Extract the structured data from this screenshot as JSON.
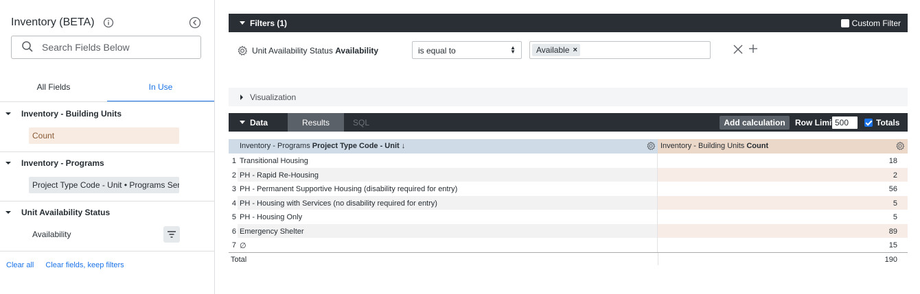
{
  "sidebar": {
    "title": "Inventory (BETA)",
    "search_placeholder": "Search Fields Below",
    "tabs": [
      {
        "label": "All Fields",
        "active": false
      },
      {
        "label": "In Use",
        "active": true
      }
    ],
    "groups": [
      {
        "title": "Inventory - Building Units",
        "field": "Count",
        "field_type": "measure"
      },
      {
        "title": "Inventory - Programs",
        "field": "Project Type Code - Unit • Programs Ser...",
        "field_type": "dimension"
      },
      {
        "title": "Unit Availability Status",
        "field": "Availability",
        "field_type": "filter"
      }
    ],
    "links": {
      "clear_all": "Clear all",
      "clear_keep": "Clear fields, keep filters"
    }
  },
  "filters": {
    "label": "Filters (1)",
    "custom_filter_label": "Custom Filter",
    "custom_filter_checked": false,
    "row": {
      "field_prefix": "Unit Availability Status",
      "field_name": "Availability",
      "operator": "is equal to",
      "value": "Available",
      "remove_chip": "×"
    }
  },
  "visualization": {
    "label": "Visualization"
  },
  "data_bar": {
    "label": "Data",
    "tabs": [
      "Results",
      "SQL"
    ],
    "add_calculation": "Add calculation",
    "row_limit_label": "Row Limit",
    "row_limit_value": "500",
    "totals_label": "Totals",
    "totals_checked": true
  },
  "table": {
    "dim_header_prefix": "Inventory - Programs",
    "dim_header_name": "Project Type Code - Unit ↓",
    "meas_header_prefix": "Inventory - Building Units",
    "meas_header_name": "Count",
    "rows": [
      {
        "n": "1",
        "dim": "Transitional Housing",
        "count": "18"
      },
      {
        "n": "2",
        "dim": "PH - Rapid Re-Housing",
        "count": "2"
      },
      {
        "n": "3",
        "dim": "PH - Permanent Supportive Housing (disability required for entry)",
        "count": "56"
      },
      {
        "n": "4",
        "dim": "PH - Housing with Services (no disability required for entry)",
        "count": "5"
      },
      {
        "n": "5",
        "dim": "PH - Housing Only",
        "count": "5"
      },
      {
        "n": "6",
        "dim": "Emergency Shelter",
        "count": "89"
      },
      {
        "n": "7",
        "dim": "∅",
        "count": "15"
      }
    ],
    "total_label": "Total",
    "total_value": "190"
  },
  "colors": {
    "accent": "#1a73e8",
    "dark_bar": "#2a2f35",
    "dimension_header": "#cfdbe7",
    "measure_header": "#ecd8c8"
  }
}
